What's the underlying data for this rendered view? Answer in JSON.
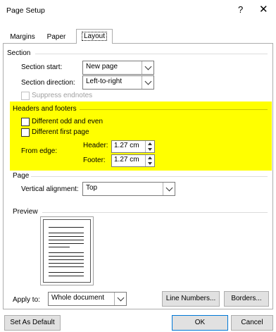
{
  "window": {
    "title": "Page Setup",
    "help_label": "?",
    "close_label": "✕"
  },
  "tabs": [
    {
      "label": "Margins",
      "selected": false
    },
    {
      "label": "Paper",
      "selected": false
    },
    {
      "label": "Layout",
      "selected": true
    }
  ],
  "section": {
    "group_title": "Section",
    "start_label": "Section start:",
    "start_value": "New page",
    "direction_label": "Section direction:",
    "direction_value": "Left-to-right",
    "suppress_label": "Suppress endnotes",
    "suppress_checked": false,
    "suppress_enabled": false
  },
  "headers_footers": {
    "group_title": "Headers and footers",
    "odd_even_label": "Different odd and even",
    "odd_even_checked": false,
    "first_page_label": "Different first page",
    "first_page_checked": false,
    "from_edge_label": "From edge:",
    "header_label": "Header:",
    "header_value": "1.27 cm",
    "footer_label": "Footer:",
    "footer_value": "1.27 cm",
    "highlight_color": "#ffff00"
  },
  "page": {
    "group_title": "Page",
    "vertical_alignment_label": "Vertical alignment:",
    "vertical_alignment_value": "Top"
  },
  "preview": {
    "group_title": "Preview"
  },
  "apply": {
    "label": "Apply to:",
    "value": "Whole document"
  },
  "buttons": {
    "line_numbers": "Line Numbers...",
    "borders": "Borders...",
    "set_default": "Set As Default",
    "ok": "OK",
    "cancel": "Cancel"
  },
  "icons": {
    "close": "close-icon",
    "dropdown": "chevron-down-icon",
    "spin_up": "spin-up-icon",
    "spin_down": "spin-down-icon"
  }
}
